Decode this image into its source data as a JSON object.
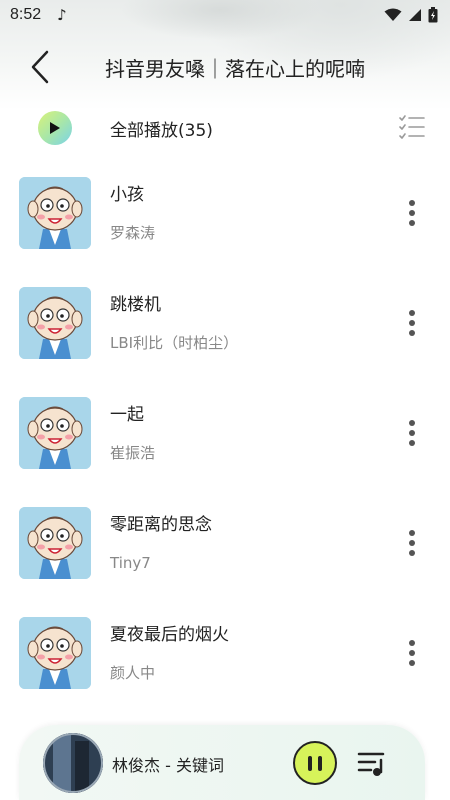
{
  "status_bar": {
    "time": "8:52",
    "icons": [
      "music-note-icon",
      "wifi-icon",
      "signal-icon",
      "battery-icon"
    ]
  },
  "header": {
    "back_icon": "chevron-left-icon",
    "title": "抖音男友嗓｜落在心上的呢喃"
  },
  "play_all": {
    "label": "全部播放(35)",
    "icon": "play-icon",
    "multiselect_icon": "checklist-icon"
  },
  "songs": [
    {
      "title": "小孩",
      "artist": "罗森涛"
    },
    {
      "title": "跳楼机",
      "artist": "LBI利比（时柏尘）"
    },
    {
      "title": "一起",
      "artist": "崔振浩"
    },
    {
      "title": "零距离的思念",
      "artist": "Tiny7"
    },
    {
      "title": "夏夜最后的烟火",
      "artist": "颜人中"
    }
  ],
  "player": {
    "now_playing": "林俊杰 - 关键词",
    "pause_icon": "pause-icon",
    "playlist_icon": "playlist-icon"
  },
  "colors": {
    "accent": "#d7f35a",
    "play_gradient_start": "#d9f27a",
    "play_gradient_end": "#7ad3e8",
    "cover_bg": "#a9d6ea"
  }
}
